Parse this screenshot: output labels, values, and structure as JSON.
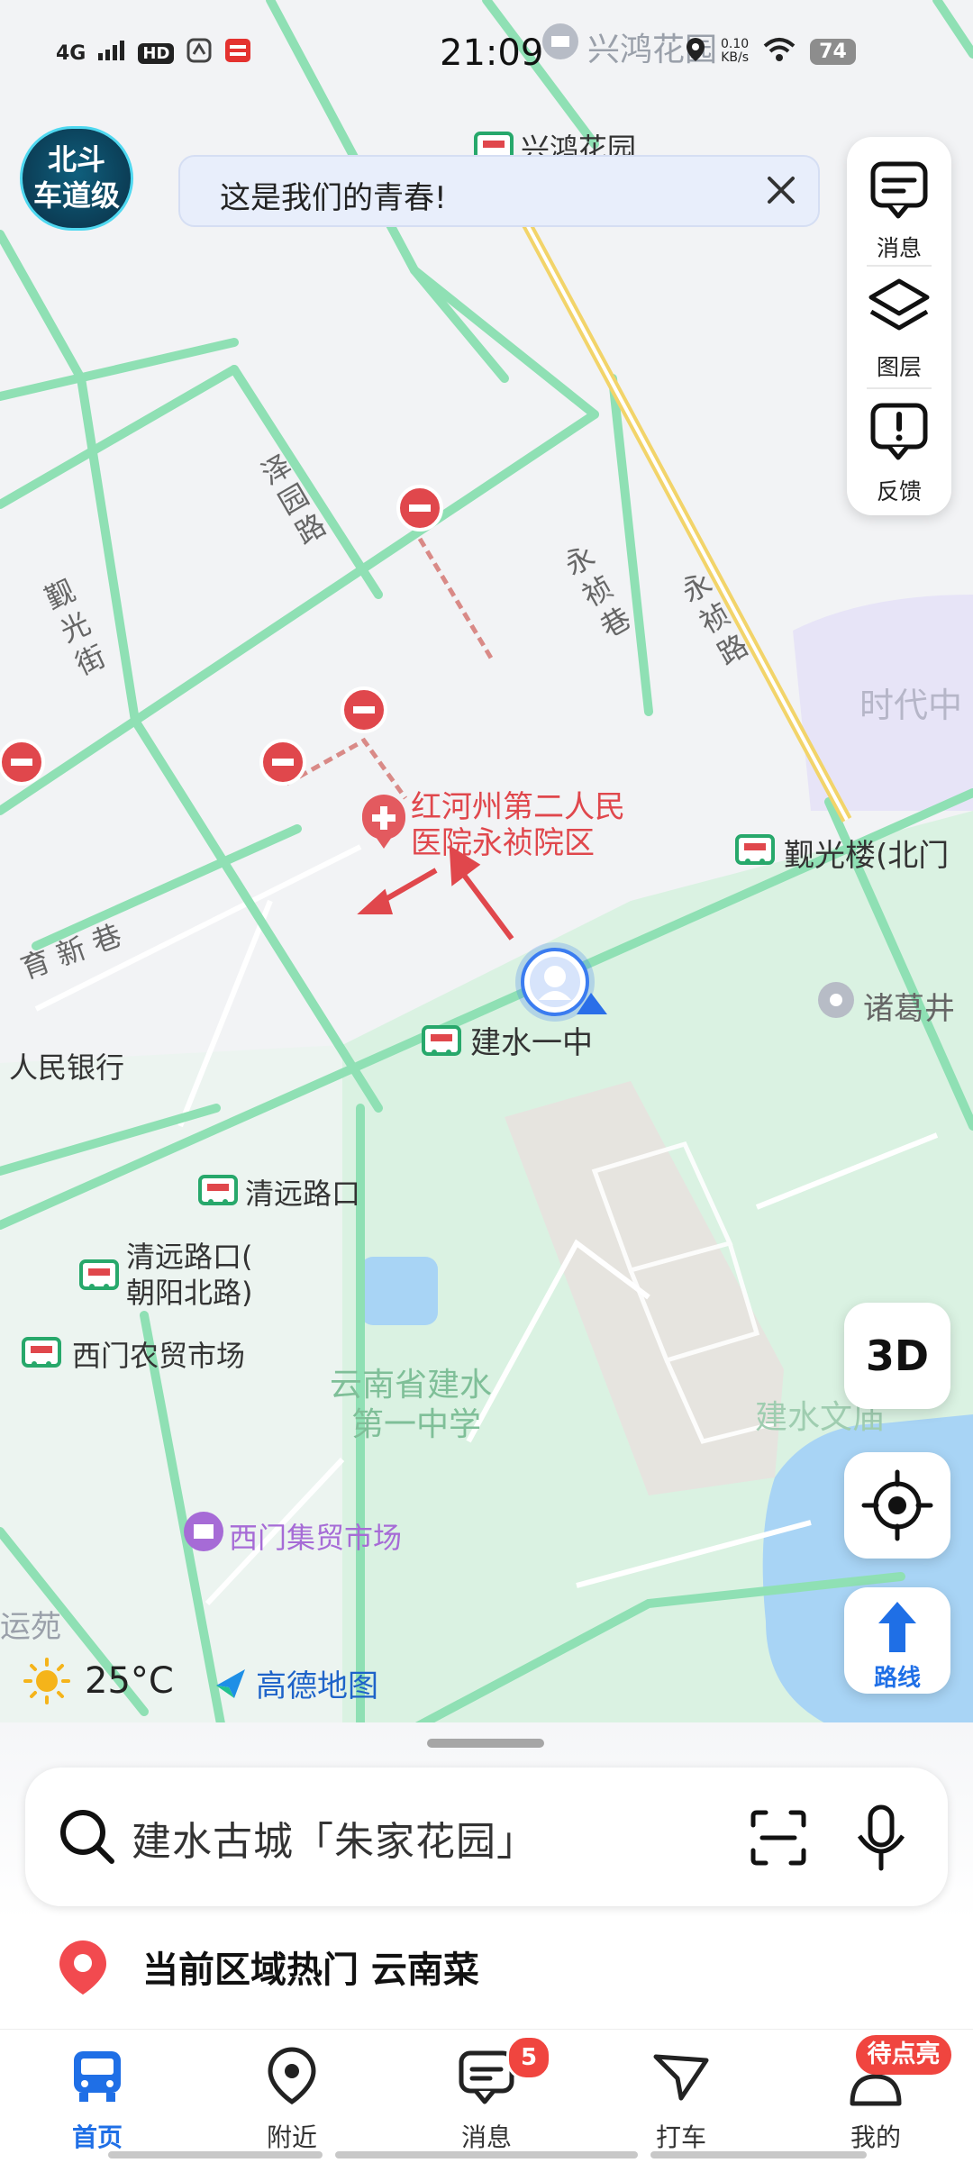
{
  "status_bar": {
    "network": "4G",
    "hd": "HD",
    "time": "21:09",
    "net_speed_value": "0.10",
    "net_speed_unit": "KB/s",
    "battery": "74"
  },
  "beidou_badge": {
    "line1": "北斗",
    "line2": "车道级"
  },
  "banner": {
    "text": "这是我们的青春!"
  },
  "tools": [
    {
      "label": "消息",
      "icon": "message-icon"
    },
    {
      "label": "图层",
      "icon": "layers-icon"
    },
    {
      "label": "反馈",
      "icon": "feedback-icon"
    }
  ],
  "map": {
    "labels": {
      "xinghong_top": "兴鸿花园",
      "xinghong_mid": "兴鸿花园",
      "zeyuan_road": "泽园路",
      "yongzhen_lane": "永祯巷",
      "yongzhen_road": "永祯路",
      "guanguang_street": "觐光街",
      "shidai": "时代中",
      "hospital_line1": "红河州第二人民",
      "hospital_line2": "医院永祯院区",
      "guanguang_building": "觐光楼(北门",
      "yuxin_lane": "育新巷",
      "zhuge_well": "诸葛井",
      "jianshui_no1": "建水一中",
      "peoples_bank": "人民银行",
      "qingyuan_crossing": "清远路口",
      "qingyuan_chaoyang_line1": "清远路口(",
      "qingyuan_chaoyang_line2": "朝阳北路)",
      "ximen_farm_market": "西门农贸市场",
      "school_line1": "云南省建水",
      "school_line2": "第一中学",
      "wenmiao": "建水文庙",
      "ximen_bazaar": "西门集贸市场",
      "yunyuan": "运苑"
    }
  },
  "buttons": {
    "three_d": "3D",
    "route": "路线"
  },
  "weather": {
    "temp": "25°C"
  },
  "brand": {
    "name": "高德地图"
  },
  "search": {
    "placeholder": "建水古城「朱家花园」"
  },
  "hot": {
    "text": "当前区域热门 云南菜"
  },
  "tabs": [
    {
      "label": "首页",
      "active": true
    },
    {
      "label": "附近",
      "active": false
    },
    {
      "label": "消息",
      "active": false,
      "badge": "5"
    },
    {
      "label": "打车",
      "active": false
    },
    {
      "label": "我的",
      "active": false,
      "badge": "待点亮"
    }
  ],
  "colors": {
    "accent": "#1f6fe6",
    "road_green": "#8fe0b4",
    "route_red": "#e0474c",
    "park_green": "#daf2e2",
    "badge_red": "#f0453f"
  }
}
